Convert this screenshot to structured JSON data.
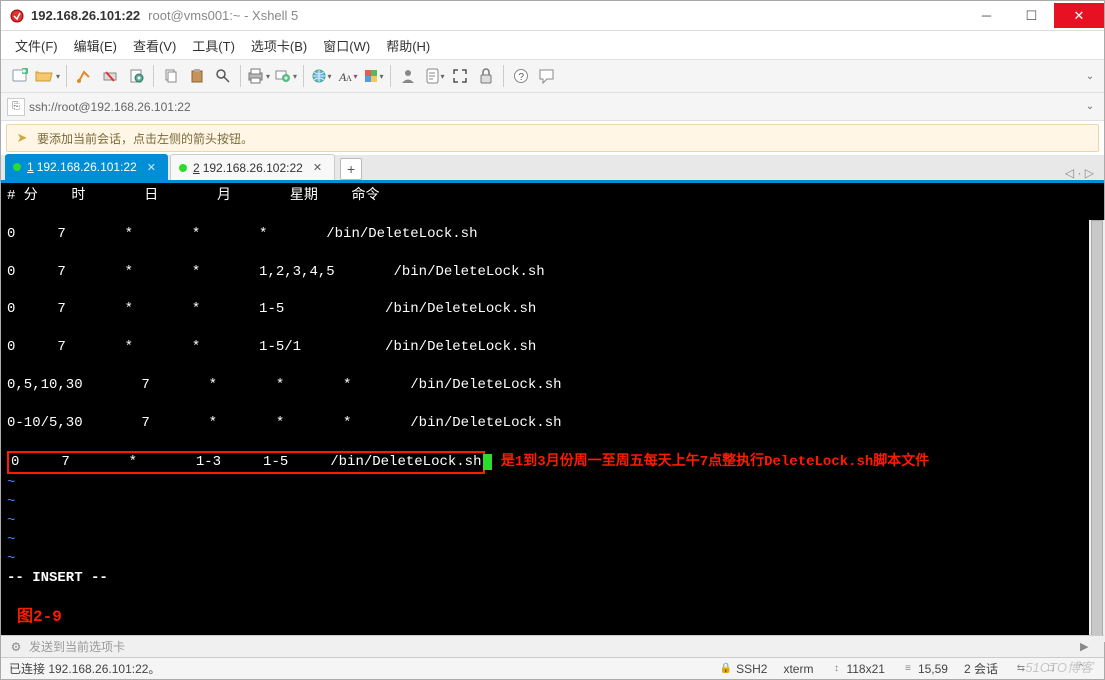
{
  "title": {
    "ip": "192.168.26.101:22",
    "subtitle": "root@vms001:~ - Xshell 5"
  },
  "menus": {
    "file": "文件(F)",
    "edit": "编辑(E)",
    "view": "查看(V)",
    "tool": "工具(T)",
    "tabs": "选项卡(B)",
    "window": "窗口(W)",
    "help": "帮助(H)"
  },
  "address": {
    "url": "ssh://root@192.168.26.101:22"
  },
  "hint": {
    "text": "要添加当前会话，点击左侧的箭头按钮。"
  },
  "tabs": {
    "items": [
      {
        "num": "1",
        "label": "192.168.26.101:22"
      },
      {
        "num": "2",
        "label": "192.168.26.102:22"
      }
    ]
  },
  "terminal": {
    "header": "# 分    时       日       月       星期    命令",
    "rows": [
      "0     7       *       *       *       /bin/DeleteLock.sh",
      "0     7       *       *       1,2,3,4,5       /bin/DeleteLock.sh",
      "0     7       *       *       1-5            /bin/DeleteLock.sh",
      "0     7       *       *       1-5/1          /bin/DeleteLock.sh",
      "0,5,10,30       7       *       *       *       /bin/DeleteLock.sh",
      "0-10/5,30       7       *       *       *       /bin/DeleteLock.sh"
    ],
    "highlight_row": "0     7       *       1-3     1-5     /bin/DeleteLock.sh",
    "annotation": "是1到3月份周一至周五每天上午7点整执行DeleteLock.sh脚本文件",
    "tilde": "~",
    "insert": "-- INSERT --",
    "figure": "图2-9"
  },
  "sendbar": {
    "placeholder": "发送到当前选项卡"
  },
  "status": {
    "conn": "已连接 192.168.26.101:22。",
    "ssh": "SSH2",
    "term": "xterm",
    "size": "118x21",
    "pos": "15,59",
    "sess": "2 会话"
  },
  "watermark": "51CTO博客",
  "icons": {
    "minimize": "─",
    "maximize": "☐",
    "close": "✕",
    "lock": "🔒",
    "plus": "+",
    "nav": "◁ · ▷",
    "arrow_r": "➤",
    "caret_up": "⌃",
    "caret_down": "⌄",
    "list": "≡",
    "updown": "↕",
    "doublearrow": "⇆",
    "cap": "□",
    "gear": "⚙",
    "send": "▶"
  }
}
